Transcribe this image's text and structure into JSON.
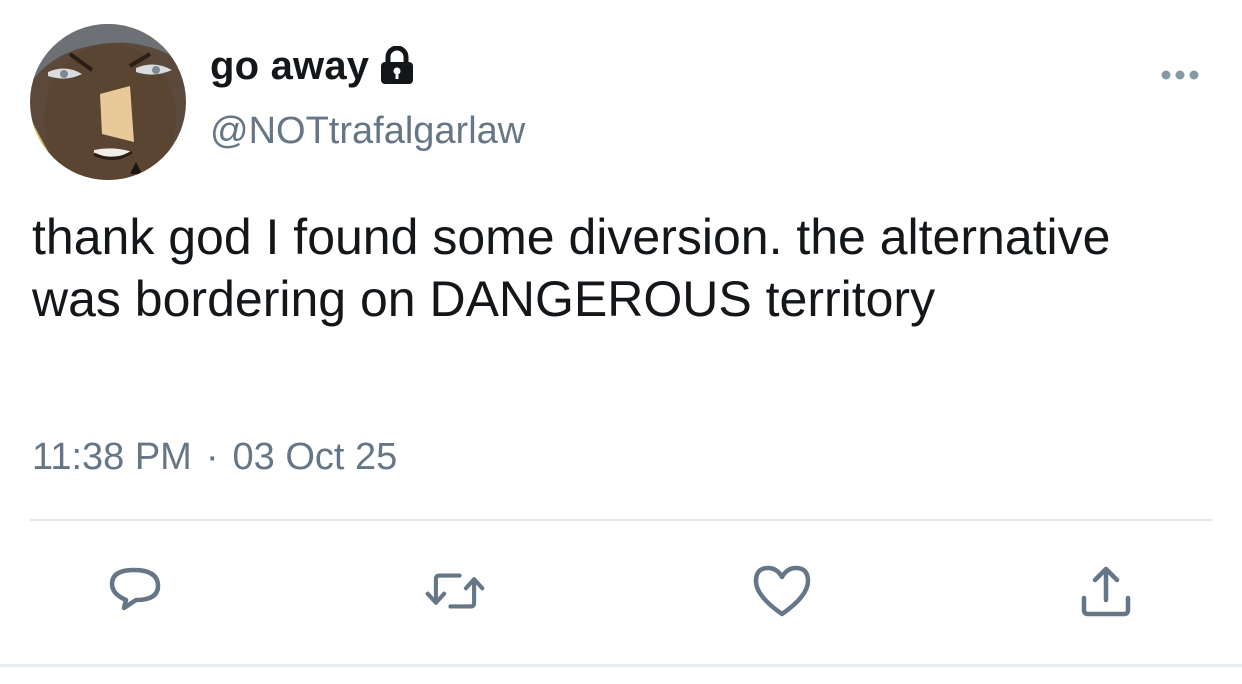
{
  "tweet": {
    "display_name": "go away",
    "protected_icon": "lock-icon",
    "handle": "@NOTtrafalgarlaw",
    "text": "thank god I found some diversion. the alternative was bordering on DANGEROUS territory",
    "time": "11:38 PM",
    "separator": "·",
    "date": "03 Oct 25"
  },
  "actions": {
    "reply_icon": "reply-icon",
    "retweet_icon": "retweet-icon",
    "like_icon": "heart-icon",
    "share_icon": "share-icon"
  },
  "colors": {
    "text_primary": "#14171a",
    "text_secondary": "#657786",
    "divider": "#e1e8ed"
  }
}
